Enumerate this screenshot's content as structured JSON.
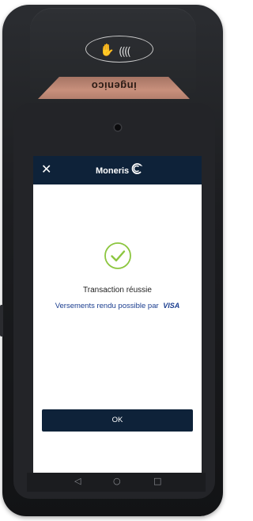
{
  "device": {
    "brand": "ingenico"
  },
  "app_bar": {
    "close_symbol": "✕",
    "logo_text": "Moneris"
  },
  "main": {
    "status": "Transaction réussie",
    "visa_text": "Versements rendu possible par",
    "visa_brand": "VISA",
    "ok_label": "OK"
  },
  "nav": {
    "back": "◁",
    "home": "○",
    "recent": "□"
  },
  "icons": {
    "close": "close-icon",
    "success": "check-circle-icon",
    "contactless": "contactless-icon",
    "back": "back-icon",
    "home": "home-icon",
    "recent": "recent-apps-icon"
  },
  "colors": {
    "brand_navy": "#0e2239",
    "success_green": "#8cc63f",
    "visa_blue": "#1a3d8f"
  }
}
